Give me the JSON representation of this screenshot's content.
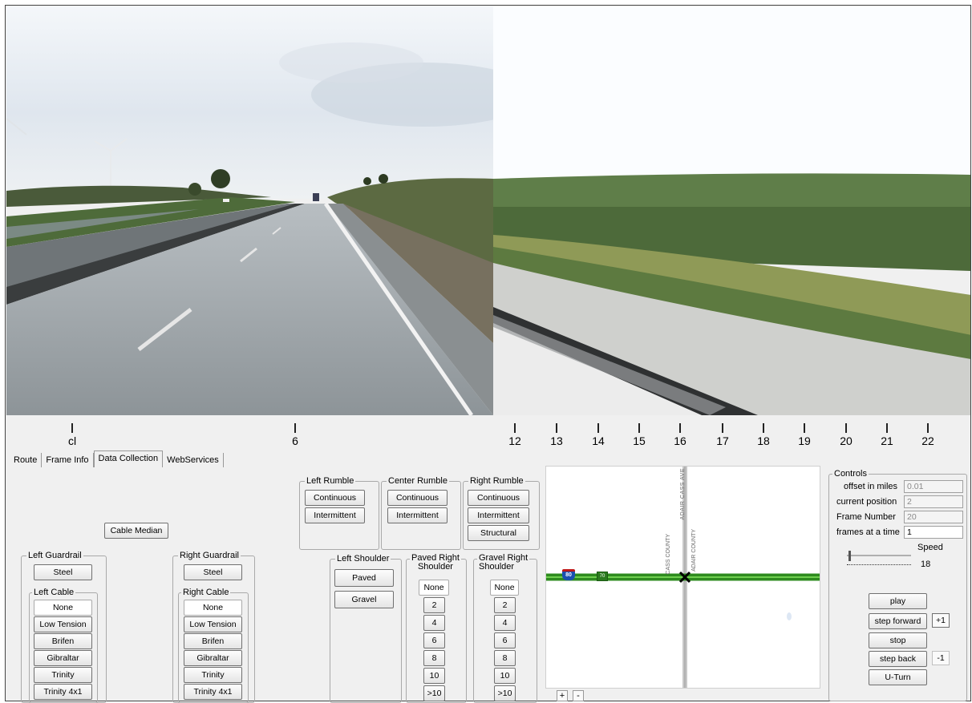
{
  "ruler": {
    "ticks": [
      {
        "label": "cl"
      },
      {
        "label": "6"
      },
      {
        "label": "12"
      },
      {
        "label": "13"
      },
      {
        "label": "14"
      },
      {
        "label": "15"
      },
      {
        "label": "16"
      },
      {
        "label": "17"
      },
      {
        "label": "18"
      },
      {
        "label": "19"
      },
      {
        "label": "20"
      },
      {
        "label": "21"
      },
      {
        "label": "22"
      }
    ]
  },
  "tabs": [
    {
      "label": "Route"
    },
    {
      "label": "Frame Info"
    },
    {
      "label": "Data Collection"
    },
    {
      "label": "WebServices"
    }
  ],
  "active_tab": "Data Collection",
  "cable_median": "Cable Median",
  "left_guardrail": {
    "title": "Left Guardrail",
    "steel": "Steel",
    "cable_title": "Left Cable",
    "cable_options": [
      "None",
      "Low Tension",
      "Brifen",
      "Gibraltar",
      "Trinity",
      "Trinity 4x1"
    ],
    "selected": "None"
  },
  "right_guardrail": {
    "title": "Right Guardrail",
    "steel": "Steel",
    "cable_title": "Right Cable",
    "cable_options": [
      "None",
      "Low Tension",
      "Brifen",
      "Gibraltar",
      "Trinity",
      "Trinity 4x1"
    ],
    "selected": "None"
  },
  "left_rumble": {
    "title": "Left Rumble",
    "options": [
      "Continuous",
      "Intermittent"
    ]
  },
  "center_rumble": {
    "title": "Center Rumble",
    "options": [
      "Continuous",
      "Intermittent"
    ]
  },
  "right_rumble": {
    "title": "Right Rumble",
    "options": [
      "Continuous",
      "Intermittent",
      "Structural"
    ]
  },
  "left_shoulder": {
    "title": "Left Shoulder",
    "options": [
      "Paved",
      "Gravel"
    ]
  },
  "paved_right_shoulder": {
    "title_line1": "Paved Right",
    "title_line2": "Shoulder",
    "options": [
      "None",
      "2",
      "4",
      "6",
      "8",
      "10",
      ">10"
    ],
    "selected": "None"
  },
  "gravel_right_shoulder": {
    "title_line1": "Gravel Right",
    "title_line2": "Shoulder",
    "options": [
      "None",
      "2",
      "4",
      "6",
      "8",
      "10",
      ">10"
    ],
    "selected": "None"
  },
  "map": {
    "road_label_top": "ADAIR CASS AVE",
    "county_left": "CASS COUNTY",
    "county_right": "ADAIR COUNTY",
    "shield_interstate": "80",
    "shield_state": "70",
    "zoom_in": "+",
    "zoom_out": "-",
    "colors": {
      "road": "#2e8b1f",
      "boundary": "#c8c8c8"
    }
  },
  "controls": {
    "title": "Controls",
    "offset_label": "offset in miles",
    "offset_value": "0.01",
    "position_label": "current position",
    "position_value": "2",
    "frame_label": "Frame Number",
    "frame_value": "20",
    "frames_label": "frames at a time",
    "frames_value": "1",
    "speed_label": "Speed",
    "speed_value": "18",
    "play": "play",
    "step_forward": "step forward",
    "plus_one": "+1",
    "stop": "stop",
    "step_back": "step back",
    "minus_one": "-1",
    "uturn": "U-Turn"
  }
}
